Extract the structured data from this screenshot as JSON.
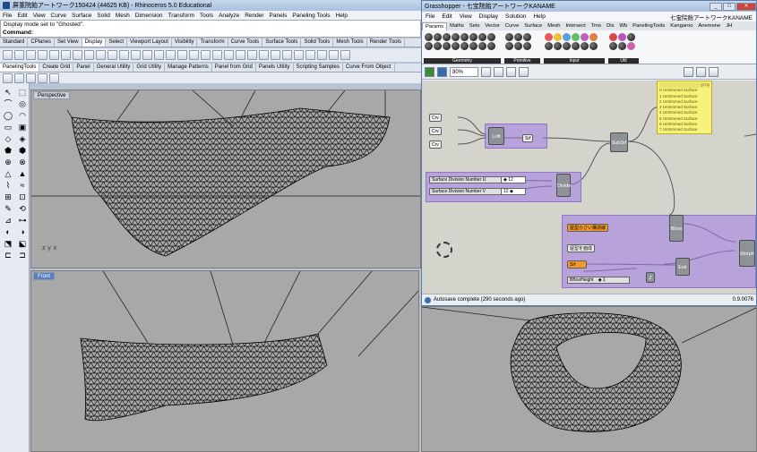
{
  "rhino": {
    "title": "屏菫院飴アートワーク150424 (44625 KB) - Rhinoceros 5.0 Educational",
    "menu": [
      "File",
      "Edit",
      "View",
      "Curve",
      "Surface",
      "Solid",
      "Mesh",
      "Dimension",
      "Transform",
      "Tools",
      "Analyze",
      "Render",
      "Panels",
      "Paneling Tools",
      "Help"
    ],
    "history": "Display mode set to \"Ghosted\".",
    "command_label": "Command:",
    "tabs": [
      "Standard",
      "CPlanes",
      "Set View",
      "Display",
      "Select",
      "Viewport Layout",
      "Visibility",
      "Transform",
      "Curve Tools",
      "Surface Tools",
      "Solid Tools",
      "Mesh Tools",
      "Render Tools"
    ],
    "active_tab": "Display",
    "tabs2": [
      "PanelingTools",
      "Create Grid",
      "Panel",
      "General Utility",
      "Grid Utility",
      "Manage Patterns",
      "Panel from Grid",
      "Panels Utility",
      "Scripting Samples",
      "Curve From Object"
    ],
    "active_tab2": "PanelingTools",
    "sidebar_icons": [
      "↖",
      "⬚",
      "⌒",
      "◎",
      "◯",
      "◠",
      "▭",
      "▣",
      "◇",
      "◈",
      "⬟",
      "⬢",
      "⊕",
      "⊗",
      "△",
      "▲",
      "⌇",
      "≈",
      "⊞",
      "⊡",
      "✎",
      "⟲",
      "⊿",
      "⊶",
      "◐",
      "◑",
      "⬔",
      "⬕",
      "⊏",
      "⊐"
    ],
    "viewports": {
      "perspective": "Perspective",
      "front": "Front"
    }
  },
  "gh": {
    "title": "Grasshopper - 七宝院飴アートワークKANAME",
    "menu": [
      "File",
      "Edit",
      "View",
      "Display",
      "Solution",
      "Help"
    ],
    "doc_name": "七宝院飴アートワークKANAME",
    "tabs": [
      "Params",
      "Maths",
      "Sets",
      "Vector",
      "Curve",
      "Surface",
      "Mesh",
      "Intersect",
      "Trns",
      "Dis",
      "Wb",
      "PanelingTools",
      "Kangaroo",
      "Anemone",
      "JH"
    ],
    "active_tab": "Params",
    "groups": [
      "Geometry",
      "Primitive",
      "Input",
      "Util"
    ],
    "zoom": "80%",
    "status": "Autosave complete (290 seconds ago)",
    "version": "0.9.0076",
    "canvas": {
      "crv1": "Crv",
      "crv2": "Crv",
      "crv3": "Crv",
      "loft": "Loft",
      "srf": "Srf",
      "slider_u_label": "Surface Division Number U",
      "slider_u_val": "◆ 12",
      "slider_v_label": "Surface Division Number V",
      "slider_v_val": "12 ◆",
      "divide": "Divide",
      "subsrf": "SubSrf",
      "bbox": "Bbox",
      "morph": "Morph",
      "extr": "Extr",
      "z": "Z",
      "p1": "屋型小さい構造線",
      "p2": "屋型を面成",
      "p3": "Srf",
      "slider_h_label": "BBoxHeight",
      "slider_h_val": "◆ 1",
      "panel_header": "(173)",
      "panel_lines": [
        "0 Untrimmed Surface",
        "1 Untrimmed Surface",
        "2 Untrimmed Surface",
        "3 Untrimmed Surface",
        "4 Untrimmed Surface",
        "5 Untrimmed Surface",
        "6 Untrimmed Surface",
        "7 Untrimmed Surface"
      ]
    }
  },
  "colors": {
    "viewport_bg": "#a8a8a8",
    "gh_canvas": "#d4d4cc",
    "group_purple": "#a078e6",
    "param_orange": "#f19a2a",
    "panel_yellow": "#f8f27a"
  }
}
